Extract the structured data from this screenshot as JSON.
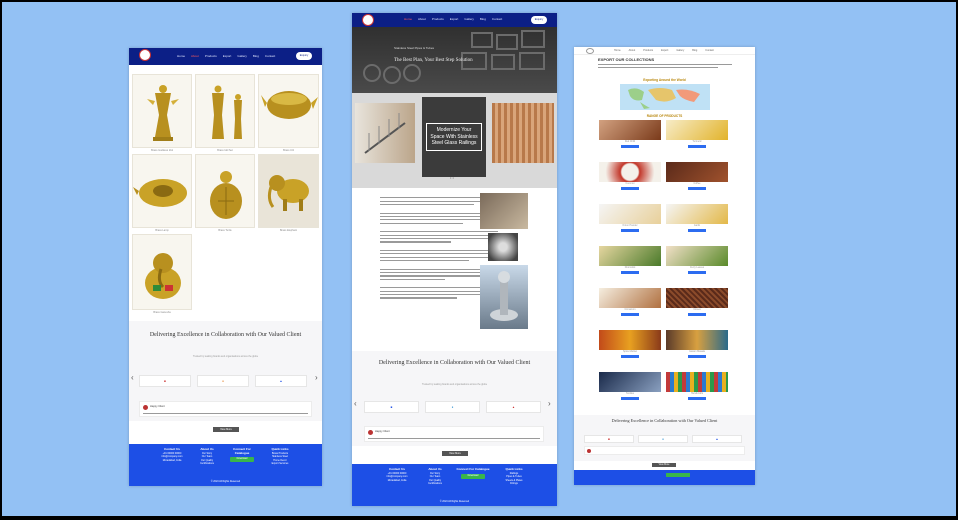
{
  "nav": {
    "items": [
      "Home",
      "About",
      "Products",
      "Export",
      "Gallery",
      "Blog",
      "Contact"
    ],
    "button": "Enquiry"
  },
  "left": {
    "products": [
      {
        "name": "Brass Goddess Idol"
      },
      {
        "name": "Brass Idol Set"
      },
      {
        "name": "Brass Urli"
      },
      {
        "name": "Brass Lamp"
      },
      {
        "name": "Brass Turtle"
      },
      {
        "name": "Brass Elephant"
      },
      {
        "name": "Brass Ganesha"
      }
    ],
    "collab_heading": "Delivering Excellence in Collaboration with Our Valued Client",
    "collab_sub": "Trusted by leading brands and organisations across the globe",
    "view_more": "View More",
    "reviewer": "Happy Client",
    "footer": {
      "contact": {
        "title": "Contact Us",
        "lines": [
          "+91 00000 00000",
          "info@company.com",
          "Moradabad, India"
        ]
      },
      "about": {
        "title": "About Us",
        "lines": [
          "Our Story",
          "Our Team",
          "Our Quality",
          "Certifications"
        ]
      },
      "connect": {
        "title": "Connect For Catalogue",
        "button": "Download"
      },
      "links": {
        "title": "Quick Links",
        "lines": [
          "Brass Products",
          "Stainless Steel",
          "Home Decor",
          "Export Services",
          "Gallery"
        ]
      },
      "copyright": "© 2024 All Rights Reserved"
    },
    "colors": {
      "accent": "#1d4fe6",
      "nav": "#0c1f86",
      "brass": "#c9a227"
    }
  },
  "middle": {
    "hero_small": "Stainless Steel Pipes & Tubes",
    "hero_title": "The Best Plan, Your Best Step Solution",
    "promo_text": "Modernize Your Space With Stainless Steel Glass Railings",
    "collab_heading": "Delivering Excellence in Collaboration with Our Valued Client",
    "collab_sub": "Trusted by leading brands and organisations across the globe",
    "view_more": "View More",
    "reviewer": "Happy Client",
    "footer": {
      "contact": {
        "title": "Contact Us",
        "lines": [
          "+91 00000 00000",
          "info@company.com",
          "Moradabad, India"
        ]
      },
      "about": {
        "title": "About Us",
        "lines": [
          "Our Story",
          "Our Team",
          "Our Quality",
          "Certifications"
        ]
      },
      "connect": {
        "title": "Connect For Catalogue",
        "button": "Download"
      },
      "links": {
        "title": "Quick Links",
        "lines": [
          "Railings",
          "Pipes & Tubes",
          "Sheets & Plates",
          "Fittings",
          "Gallery"
        ]
      },
      "copyright": "© 2024 All Rights Reserved"
    }
  },
  "right": {
    "title": "EXPORT OUR COLLECTIONS",
    "map_title": "Exporting Around the World",
    "range_title": "RANGE OF PRODUCTS",
    "products": [
      {
        "name": "Red Chilli",
        "button": "Enquire"
      },
      {
        "name": "Turmeric",
        "button": "Enquire"
      },
      {
        "name": "Coconut",
        "button": "Enquire"
      },
      {
        "name": "Coffee",
        "button": "Enquire"
      },
      {
        "name": "Onion Powder",
        "button": "Enquire"
      },
      {
        "name": "Garlic",
        "button": "Enquire"
      },
      {
        "name": "Drumstick",
        "button": "Enquire"
      },
      {
        "name": "Curry Leaves",
        "button": "Enquire"
      },
      {
        "name": "Cinnamon",
        "button": "Enquire"
      },
      {
        "name": "Cloves",
        "button": "Enquire"
      },
      {
        "name": "Spice Market",
        "button": "Enquire"
      },
      {
        "name": "Garam Masala",
        "button": "Enquire"
      },
      {
        "name": "Textiles",
        "button": "Enquire"
      },
      {
        "name": "Handicrafts",
        "button": "Enquire"
      }
    ],
    "collab_heading": "Delivering Excellence in Collaboration with Our Valued Client",
    "view_more": "View More"
  }
}
